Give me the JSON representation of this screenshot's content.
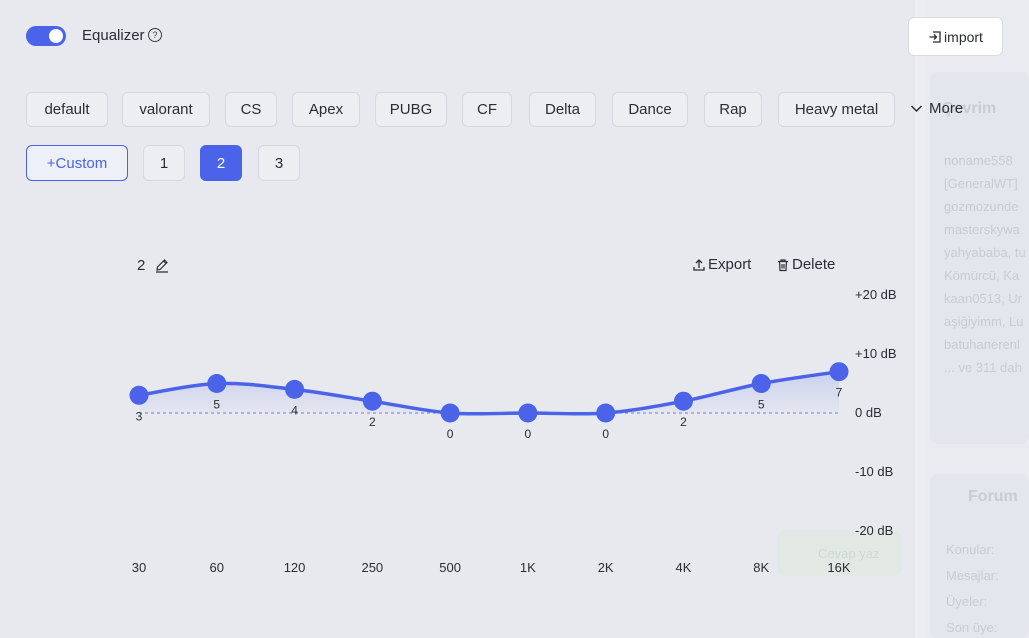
{
  "header": {
    "toggle_on": true,
    "title": "Equalizer",
    "import_label": "import"
  },
  "presets": [
    "default",
    "valorant",
    "CS",
    "Apex",
    "PUBG",
    "CF",
    "Delta",
    "Dance",
    "Rap",
    "Heavy metal"
  ],
  "more_label": "More",
  "custom": {
    "button_label": "+Custom",
    "slots": [
      "1",
      "2",
      "3"
    ],
    "active_slot": "2"
  },
  "eq_panel": {
    "name": "2",
    "export_label": "Export",
    "delete_label": "Delete"
  },
  "background_text": [
    "Çevrim",
    "noname558",
    "[GeneralWT]",
    "gozmozunde",
    "masterskywa",
    "yahyababa, tu",
    "Kömürcü, Ka",
    "kaan0513, Ur",
    "aşiğiyimm, Lu",
    "batuhanerenl",
    "... ve 311 dah",
    "Forum",
    "Konular:",
    "Mesajlar:",
    "Üyeler:",
    "Son üye:",
    "Cevap yaz"
  ],
  "chart_data": {
    "type": "line",
    "categories": [
      "30",
      "60",
      "120",
      "250",
      "500",
      "1K",
      "2K",
      "4K",
      "8K",
      "16K"
    ],
    "values": [
      3,
      5,
      4,
      2,
      0,
      0,
      0,
      2,
      5,
      7
    ],
    "y_ticks": [
      "+20 dB",
      "+10 dB",
      "0 dB",
      "-10 dB",
      "-20 dB"
    ],
    "ylim": [
      -20,
      20
    ],
    "baseline": 0,
    "title": "",
    "xlabel": "",
    "ylabel": "",
    "line_color": "#4a63e8",
    "baseline_color": "#4a63e8"
  },
  "colors": {
    "accent": "#4a63e8",
    "background": "#e7e9ef"
  }
}
